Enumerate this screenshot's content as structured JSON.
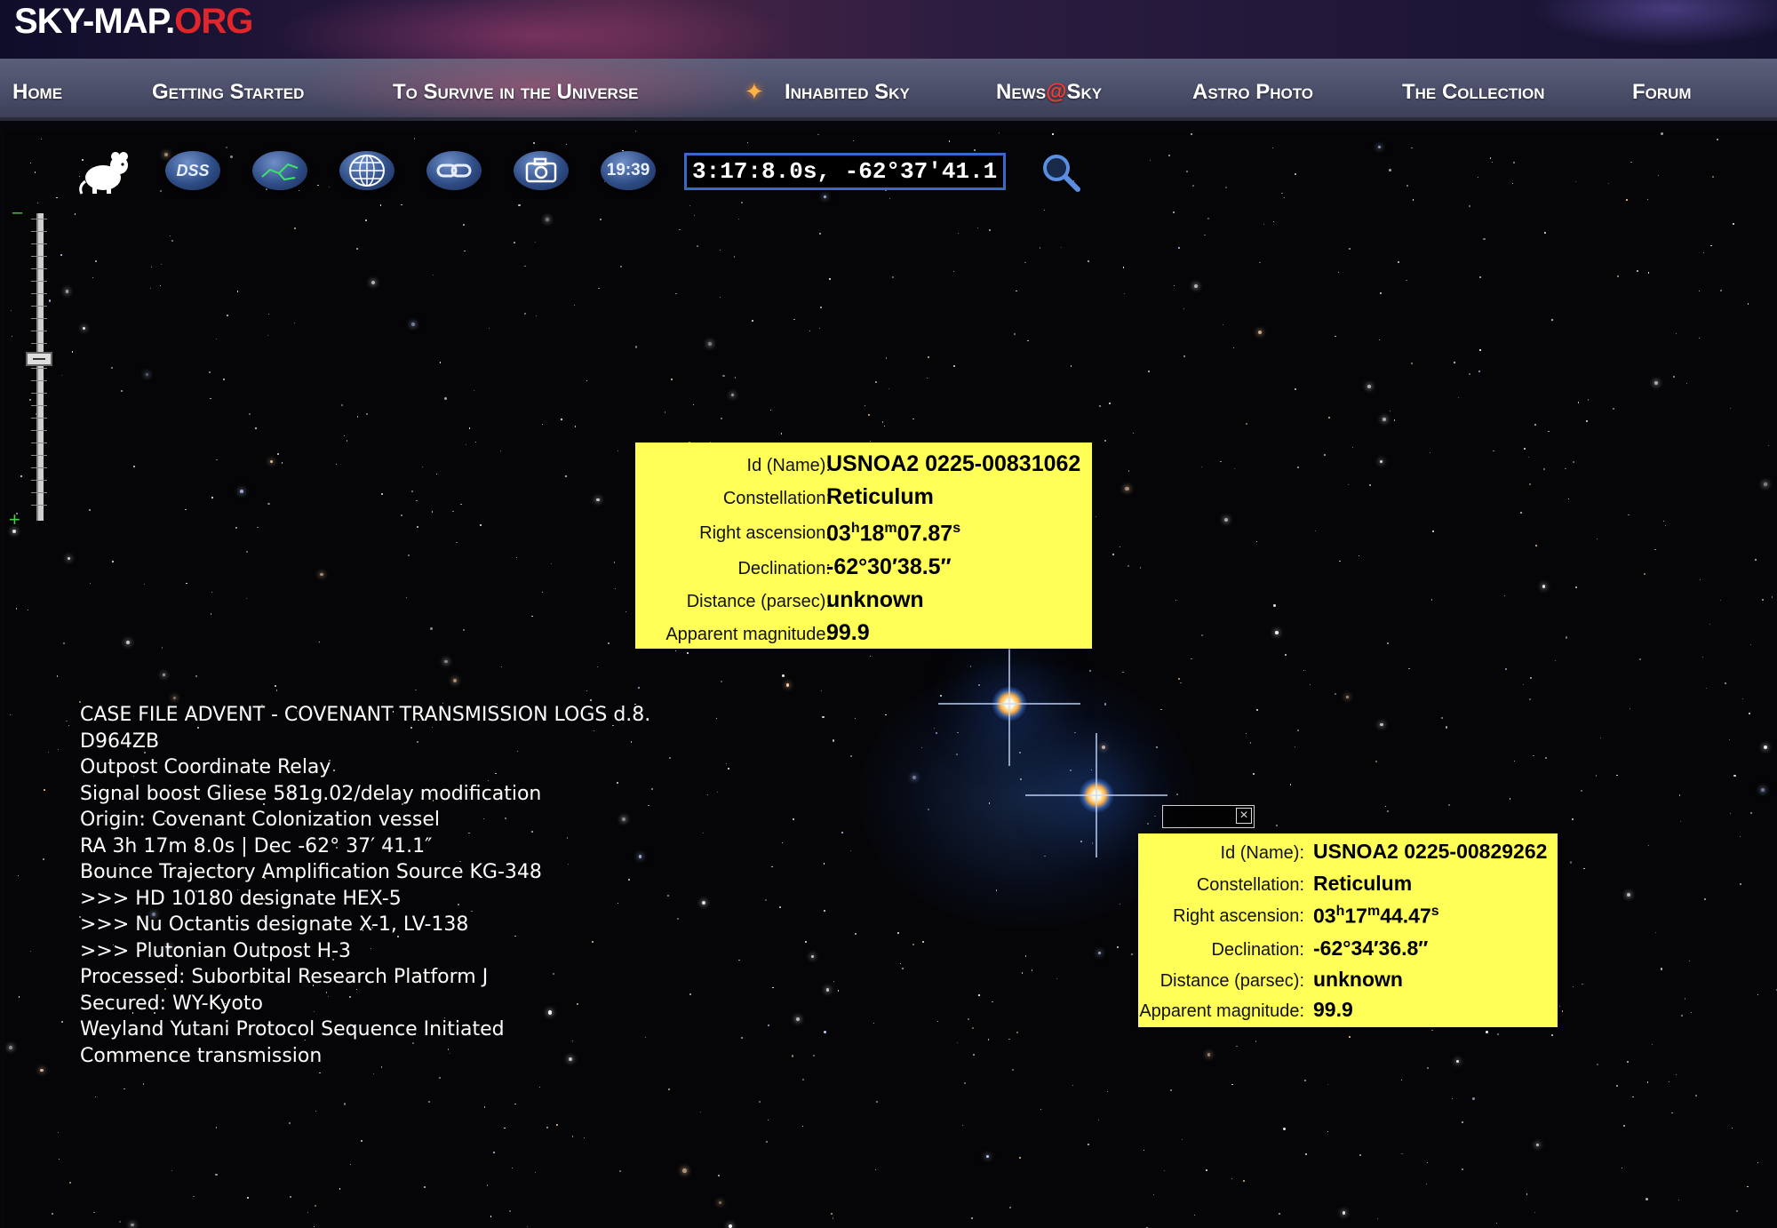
{
  "header": {
    "logo_main": "SKY-MAP.",
    "logo_org": "ORG"
  },
  "nav": {
    "items": [
      {
        "label": "Home"
      },
      {
        "label": "Getting Started"
      },
      {
        "label": "To Survive in the Universe"
      },
      {
        "label": "Inhabited Sky"
      },
      {
        "label_pre": "News",
        "label_at": "@",
        "label_post": "Sky"
      },
      {
        "label": "Astro Photo"
      },
      {
        "label": "The Collection"
      },
      {
        "label": "Forum"
      }
    ]
  },
  "toolbar": {
    "mascot_icon": "mouse-mascot-icon",
    "dss_label": "DSS",
    "time_label": "19:39",
    "coordinates_value": "3:17:8.0s, -62°37′41.1″",
    "icons": [
      "constellation-lines-icon",
      "grid-globe-icon",
      "link-icon",
      "camera-icon",
      "search-icon"
    ]
  },
  "info_box_1": {
    "id_label": "Id (Name):",
    "id_value": "USNOA2 0225-00831062",
    "constellation_label": "Constellation:",
    "constellation_value": "Reticulum",
    "ra_label": "Right ascension:",
    "ra_h": "03",
    "ra_m": "18",
    "ra_s": "07.87",
    "dec_label": "Declination:",
    "dec_value": "-62°30′38.5″",
    "dist_label": "Distance (parsec):",
    "dist_value": "unknown",
    "mag_label": "Apparent magnitude:",
    "mag_value": "99.9"
  },
  "info_box_2": {
    "id_label": "Id (Name):",
    "id_value": "USNOA2 0225-00829262",
    "constellation_label": "Constellation:",
    "constellation_value": "Reticulum",
    "ra_label": "Right ascension:",
    "ra_h": "03",
    "ra_m": "17",
    "ra_s": "44.47",
    "dec_label": "Declination:",
    "dec_value": "-62°34′36.8″",
    "dist_label": "Distance (parsec):",
    "dist_value": "unknown",
    "mag_label": "Apparent magnitude:",
    "mag_value": "99.9"
  },
  "unit_labels": {
    "h": "h",
    "m": "m",
    "s": "s"
  },
  "log_lines": [
    "CASE FILE ADVENT - COVENANT TRANSMISSION LOGS d.8.",
    "D964ZB",
    "Outpost Coordinate Relay",
    "Signal boost Gliese 581g.02/delay modification",
    "Origin: Covenant Colonization vessel",
    "RA 3h 17m 8.0s | Dec -62° 37′ 41.1″",
    "Bounce Trajectory Amplification Source KG-348",
    ">>> HD 10180 designate HEX-5",
    ">>> Nu Octantis designate X-1, LV-138",
    ">>> Plutonian Outpost H-3",
    "Processed: Suborbital Research Platform J",
    "Secured: WY-Kyoto",
    "Weyland Yutani Protocol Sequence Initiated",
    "Commence transmission"
  ],
  "colors": {
    "info_box_bg": "#ffff57",
    "logo_org": "#e0262b",
    "nav_bg": "#4a4d68",
    "input_border": "#3a68c8"
  }
}
